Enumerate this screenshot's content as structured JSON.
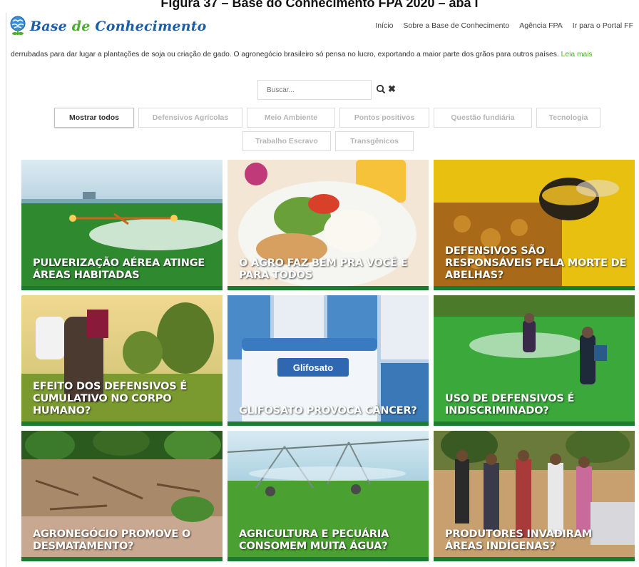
{
  "caption": "Figura 37 – Base do Conhecimento FPA 2020 – aba I",
  "logo": {
    "text_1": "Base",
    "text_2": "de",
    "text_3": "Conhecimento"
  },
  "nav": [
    "Início",
    "Sobre a Base de Conhecimento",
    "Agência FPA",
    "Ir para o Portal FF"
  ],
  "intro": {
    "text": "derrubadas para dar lugar a plantações de soja ou criação de gado. O agronegócio brasileiro só pensa no lucro, exportando a maior parte dos grãos para outros países.",
    "more": "Leia mais"
  },
  "search": {
    "placeholder": "Buscar..."
  },
  "filters": [
    "Mostrar todos",
    "Defensivos Agrícolas",
    "Meio Ambiente",
    "Pontos positivos",
    "Questão fundiária",
    "Tecnologia",
    "Trabalho Escravo",
    "Transgênicos"
  ],
  "cards": [
    {
      "title": "PULVERIZAÇÃO AÉREA ATINGE ÁREAS HABITADAS"
    },
    {
      "title": "O AGRO FAZ BEM PRA VOCÊ E PARA TODOS"
    },
    {
      "title": "DEFENSIVOS SÃO RESPONSÁVEIS PELA MORTE DE ABELHAS?"
    },
    {
      "title": "EFEITO DOS DEFENSIVOS É CUMULATIVO NO CORPO HUMANO?"
    },
    {
      "title": "GLIFOSATO PROVOCA CÂNCER?",
      "label": "Glifosato"
    },
    {
      "title": "USO DE DEFENSIVOS É INDISCRIMINADO?"
    },
    {
      "title": "AGRONEGÓCIO PROMOVE O DESMATAMENTO?"
    },
    {
      "title": "AGRICULTURA E PECUÁRIA CONSOMEM MUITA ÁGUA?"
    },
    {
      "title": "PRODUTORES INVADIRAM ÁREAS INDÍGENAS?"
    }
  ],
  "colors": {
    "brand_blue": "#1a5fa8",
    "brand_green": "#4caf30",
    "card_bar": "#1e7a2e"
  }
}
